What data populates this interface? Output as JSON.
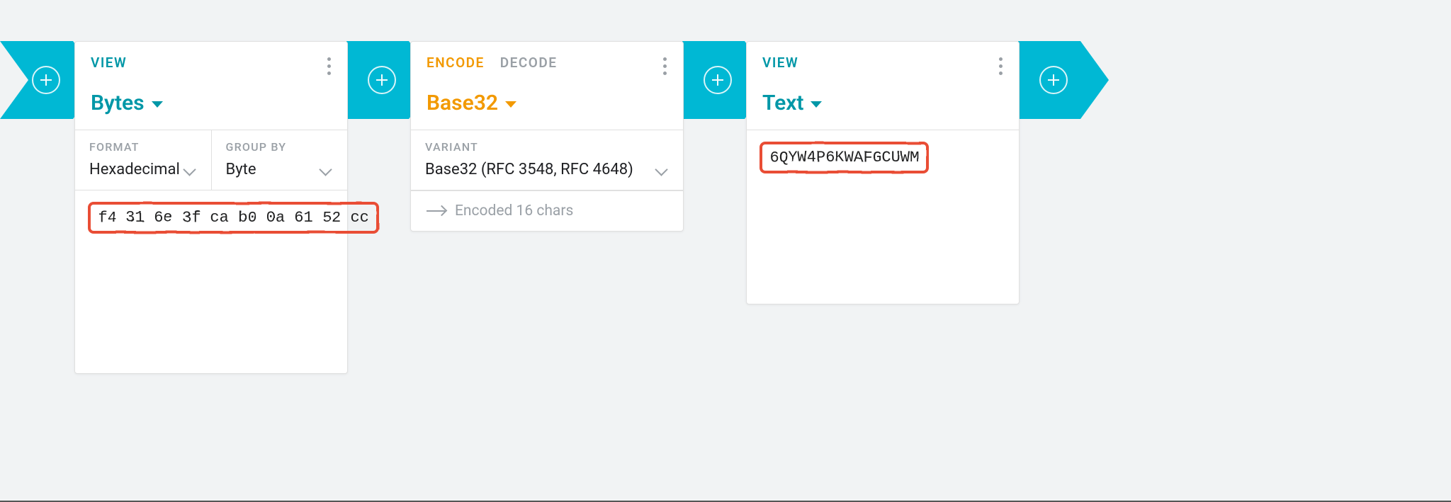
{
  "connectors": {
    "add_label": "+"
  },
  "bytes_card": {
    "tabs": {
      "view": "VIEW"
    },
    "title": "Bytes",
    "settings": {
      "format_label": "FORMAT",
      "format_value": "Hexadecimal",
      "groupby_label": "GROUP BY",
      "groupby_value": "Byte"
    },
    "content": "f4 31 6e 3f ca b0 0a 61 52 cc"
  },
  "base32_card": {
    "tabs": {
      "encode": "ENCODE",
      "decode": "DECODE"
    },
    "title": "Base32",
    "settings": {
      "variant_label": "VARIANT",
      "variant_value": "Base32 (RFC 3548, RFC 4648)"
    },
    "status": "Encoded 16 chars"
  },
  "text_card": {
    "tabs": {
      "view": "VIEW"
    },
    "title": "Text",
    "content": "6QYW4P6KWAFGCUWM"
  }
}
